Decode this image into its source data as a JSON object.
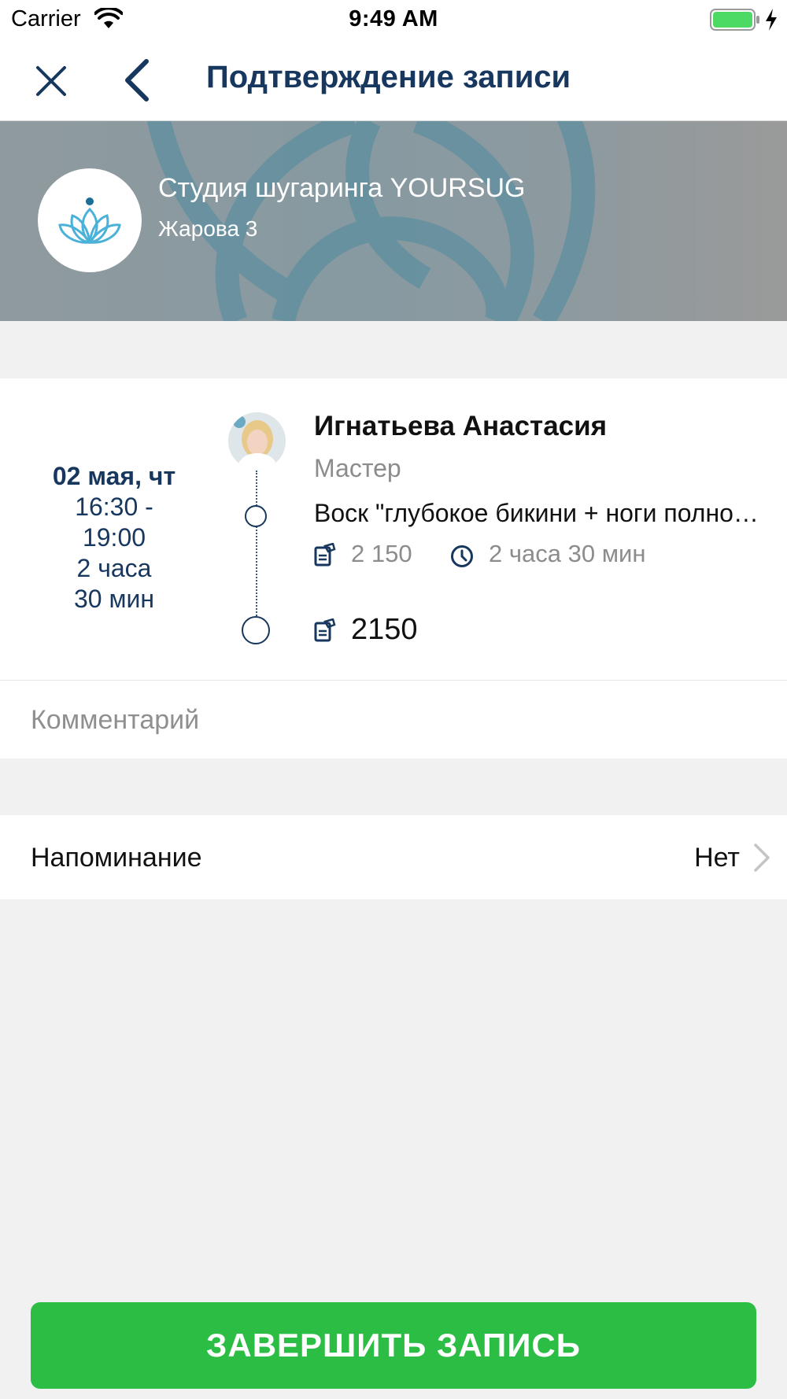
{
  "status_bar": {
    "carrier": "Carrier",
    "time": "9:49 AM"
  },
  "nav": {
    "title": "Подтверждение записи",
    "close_icon": "close-icon",
    "back_icon": "chevron-left-icon"
  },
  "studio": {
    "name": "Студия шугаринга YOURSUG",
    "address": "Жарова 3",
    "logo_icon": "lotus-icon"
  },
  "appointment": {
    "date": "02 мая, чт",
    "time_range_start": "16:30 -",
    "time_range_end": "19:00",
    "duration_hours": "2 часа",
    "duration_minutes": "30 мин",
    "master_name": "Игнатьева Анастасия",
    "master_role": "Мастер",
    "service": "Воск \"глубокое бикини + ноги полностью\"",
    "service_price": "2 150",
    "service_duration": "2 часа 30 мин",
    "total": "2150"
  },
  "comment": {
    "placeholder": "Комментарий",
    "value": ""
  },
  "reminder": {
    "label": "Напоминание",
    "value": "Нет"
  },
  "finish_button": {
    "label": "ЗАВЕРШИТЬ ЗАПИСЬ"
  },
  "colors": {
    "primary_dark_blue": "#17375e",
    "button_green": "#2cbd45",
    "background_gray": "#f1f1f1",
    "muted_text": "#8c8c8c"
  }
}
